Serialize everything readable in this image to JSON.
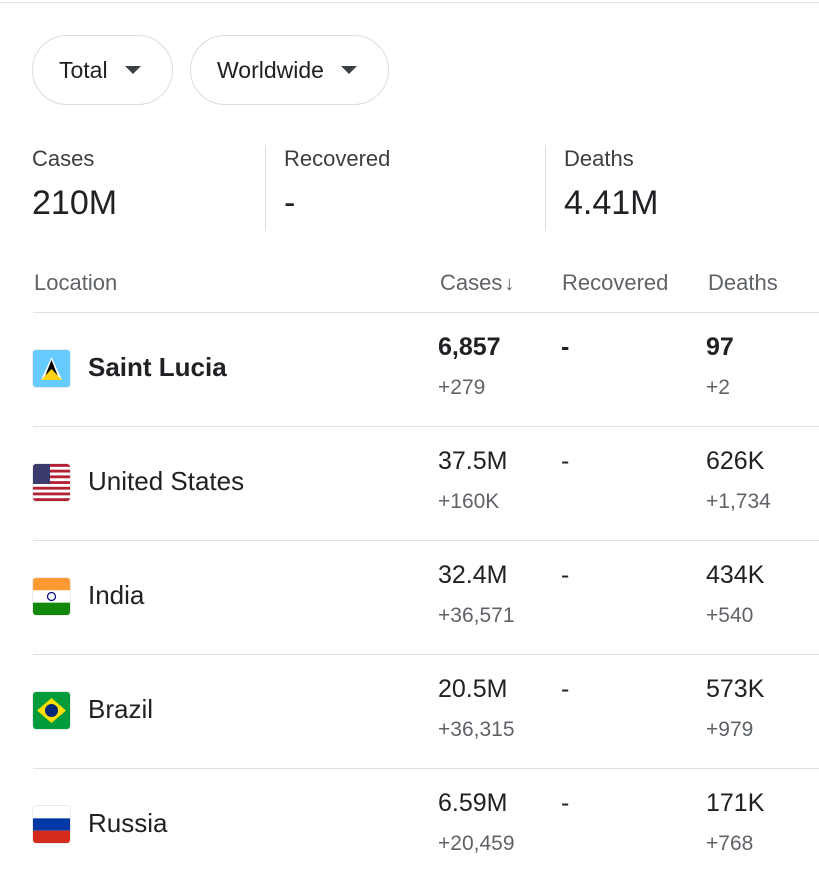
{
  "filters": [
    {
      "label": "Total"
    },
    {
      "label": "Worldwide"
    }
  ],
  "summary": {
    "cases": {
      "label": "Cases",
      "value": "210M"
    },
    "recovered": {
      "label": "Recovered",
      "value": "-"
    },
    "deaths": {
      "label": "Deaths",
      "value": "4.41M"
    }
  },
  "table": {
    "headers": {
      "location": "Location",
      "cases": "Cases",
      "sort_icon": "↓",
      "recovered": "Recovered",
      "deaths": "Deaths"
    },
    "rows": [
      {
        "country": "Saint Lucia",
        "flag_icon": "saint-lucia-flag-icon",
        "cases": "6,857",
        "cases_new": "+279",
        "recovered": "-",
        "deaths": "97",
        "deaths_new": "+2",
        "highlighted": true
      },
      {
        "country": "United States",
        "flag_icon": "united-states-flag-icon",
        "cases": "37.5M",
        "cases_new": "+160K",
        "recovered": "-",
        "deaths": "626K",
        "deaths_new": "+1,734"
      },
      {
        "country": "India",
        "flag_icon": "india-flag-icon",
        "cases": "32.4M",
        "cases_new": "+36,571",
        "recovered": "-",
        "deaths": "434K",
        "deaths_new": "+540"
      },
      {
        "country": "Brazil",
        "flag_icon": "brazil-flag-icon",
        "cases": "20.5M",
        "cases_new": "+36,315",
        "recovered": "-",
        "deaths": "573K",
        "deaths_new": "+979"
      },
      {
        "country": "Russia",
        "flag_icon": "russia-flag-icon",
        "cases": "6.59M",
        "cases_new": "+20,459",
        "recovered": "-",
        "deaths": "171K",
        "deaths_new": "+768"
      }
    ]
  }
}
